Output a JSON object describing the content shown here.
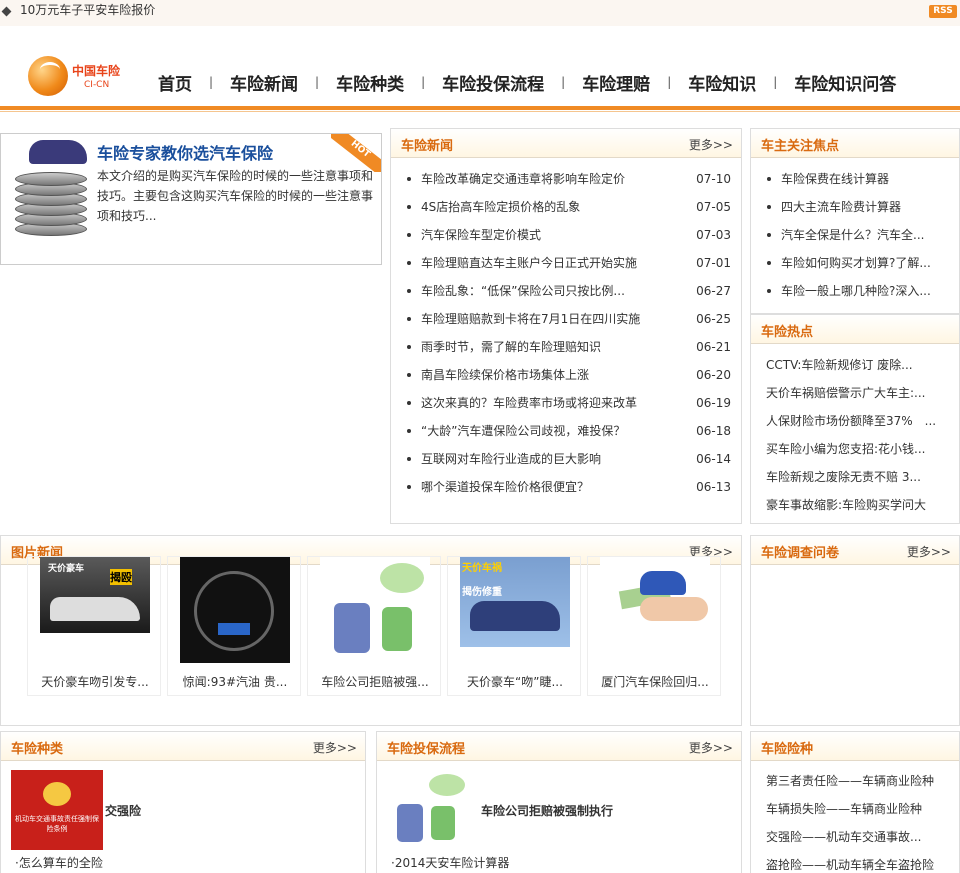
{
  "topbar": {
    "ticker": "10万元车子平安车险报价",
    "rss": "RSS"
  },
  "logo": {
    "name": "中国车险",
    "sub": "CI-CN"
  },
  "nav": [
    "首页",
    "车险新闻",
    "车险种类",
    "车险投保流程",
    "车险理赔",
    "车险知识",
    "车险知识问答"
  ],
  "nav_sep": "|",
  "feature": {
    "title": "车险专家教你选汽车保险",
    "desc": "本文介绍的是购买汽车保险的时候的一些注意事项和技巧。主要包含这购买汽车保险的时候的一些注意事项和技巧...",
    "hot": "HOT"
  },
  "news": {
    "title": "车险新闻",
    "more": "更多>>",
    "items": [
      {
        "text": "车险改革确定交通违章将影响车险定价",
        "date": "07-10"
      },
      {
        "text": "4S店抬高车险定损价格的乱象",
        "date": "07-05"
      },
      {
        "text": "汽车保险车型定价模式",
        "date": "07-03"
      },
      {
        "text": "车险理赔直达车主账户今日正式开始实施",
        "date": "07-01"
      },
      {
        "text": "车险乱象：“低保”保险公司只按比例...",
        "date": "06-27"
      },
      {
        "text": "车险理赔赔款到卡将在7月1日在四川实施",
        "date": "06-25"
      },
      {
        "text": "雨季时节，需了解的车险理赔知识",
        "date": "06-21"
      },
      {
        "text": "南昌车险续保价格市场集体上涨",
        "date": "06-20"
      },
      {
        "text": "这次来真的？车险费率市场或将迎来改革",
        "date": "06-19"
      },
      {
        "text": "“大龄”汽车遭保险公司歧视，难投保？",
        "date": "06-18"
      },
      {
        "text": "互联网对车险行业造成的巨大影响",
        "date": "06-14"
      },
      {
        "text": "哪个渠道投保车险价格很便宜？",
        "date": "06-13"
      }
    ]
  },
  "focus": {
    "title": "车主关注焦点",
    "items": [
      "车险保费在线计算器",
      "四大主流车险费计算器",
      "汽车全保是什么？汽车全...",
      "车险如何购买才划算?了解...",
      "车险一般上哪几种险?深入..."
    ]
  },
  "hot": {
    "title": "车险热点",
    "items": [
      "CCTV:车险新规修订 废除...",
      "天价车祸赔偿警示广大车主:...",
      "人保财险市场份额降至37%　...",
      "买车险小编为您支招:花小钱...",
      "车险新规之废除无责不赔 3...",
      "豪车事故缩影:车险购买学问大"
    ]
  },
  "photos": {
    "title": "图片新闻",
    "more": "更多>>",
    "items": [
      "天价豪车吻引发专...",
      "惊闻:93#汽油 贵...",
      "车险公司拒赔被强...",
      "天价豪车“吻”睫...",
      "厦门汽车保险回归..."
    ],
    "overlay1": "揭殴",
    "overlay2": "天价车祸",
    "overlay3": "揭伤修重"
  },
  "survey": {
    "title": "车险调查问卷",
    "more": "更多>>"
  },
  "types": {
    "title": "车险种类",
    "more": "更多>>",
    "feature": "交强险",
    "sub": "·怎么算车的全险",
    "doc_title": "机动车交通事故责任强制保险条例"
  },
  "process": {
    "title": "车险投保流程",
    "more": "更多>>",
    "feature": "车险公司拒赔被强制执行",
    "sub": "·2014天安车险计算器"
  },
  "kinds": {
    "title": "车险险种",
    "items": [
      "第三者责任险——车辆商业险种",
      "车辆损失险——车辆商业险种",
      "交强险——机动车交通事故...",
      "盗抢险——机动车辆全车盗抢险"
    ]
  },
  "colors": {
    "accent": "#f08a24",
    "title_text": "#d96a10",
    "link_blue": "#1a4f9c"
  }
}
